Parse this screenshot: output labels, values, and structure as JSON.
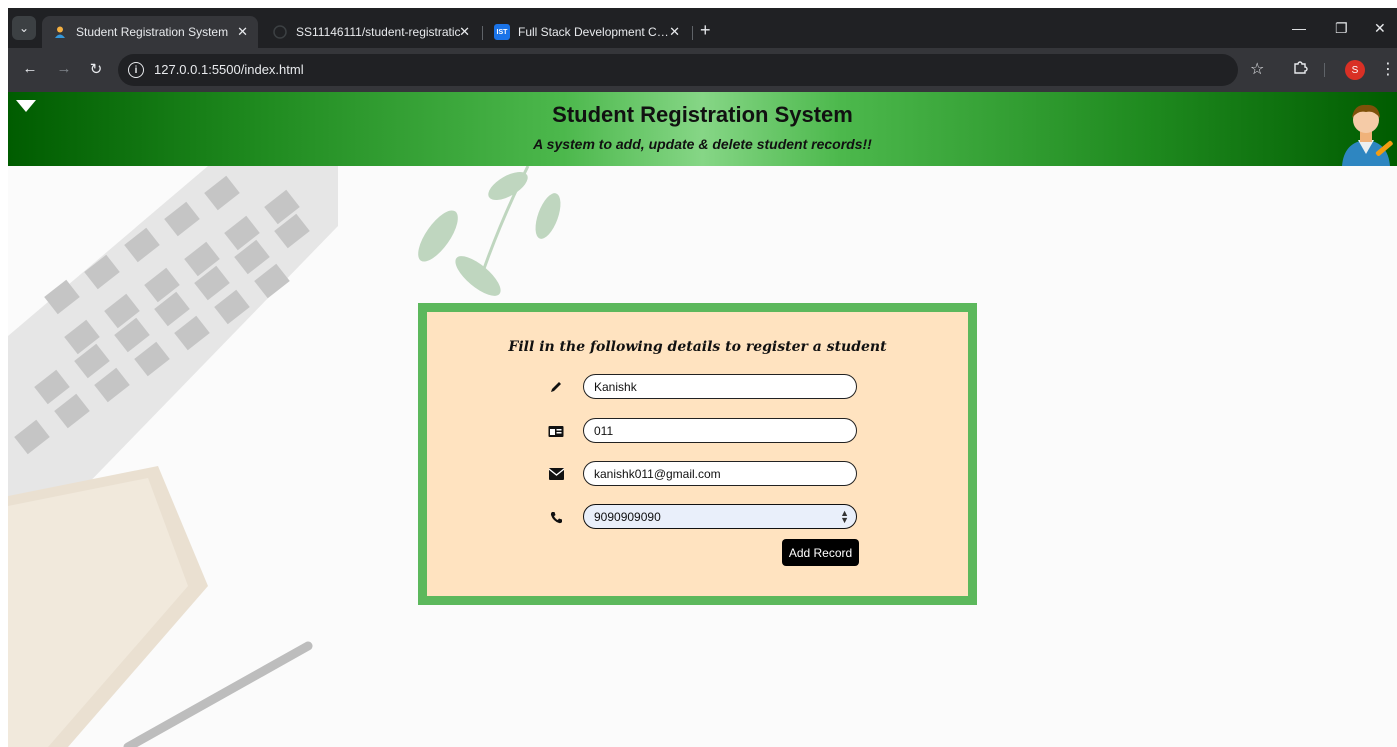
{
  "browser": {
    "tabs": [
      {
        "title": "Student Registration System",
        "active": true
      },
      {
        "title": "SS11146111/student-registratic",
        "active": false
      },
      {
        "title": "Full Stack Development Course",
        "active": false,
        "favicon_text": "IST"
      }
    ],
    "url": "127.0.0.1:5500/index.html",
    "profile_initial": "S"
  },
  "header": {
    "title": "Student Registration System",
    "subtitle": "A system to add, update & delete student records!!"
  },
  "form": {
    "heading": "Fill in the following details to register a student",
    "fields": [
      {
        "icon": "pencil-icon",
        "value": "Kanishk"
      },
      {
        "icon": "id-card-icon",
        "value": "011"
      },
      {
        "icon": "envelope-icon",
        "value": "kanishk011@gmail.com"
      },
      {
        "icon": "phone-icon",
        "value": "9090909090"
      }
    ],
    "submit_label": "Add Record"
  },
  "colors": {
    "header_dark": "#005c00",
    "header_light": "#86d686",
    "card_border": "#5cb85c",
    "card_bg": "#ffe3c0",
    "button_bg": "#000000"
  }
}
